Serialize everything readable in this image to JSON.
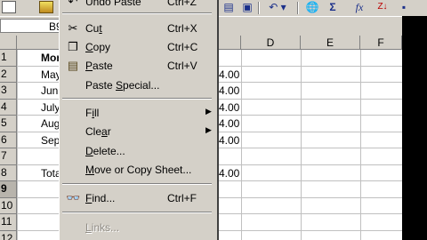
{
  "name_box": {
    "value": "B9"
  },
  "columns": [
    "D",
    "E",
    "F"
  ],
  "rows": [
    {
      "num": "1",
      "label": "Mon",
      "value": ""
    },
    {
      "num": "2",
      "label": "May",
      "value": "4.00"
    },
    {
      "num": "3",
      "label": "Jun",
      "value": "4.00"
    },
    {
      "num": "4",
      "label": "July",
      "value": "4.00"
    },
    {
      "num": "5",
      "label": "Aug",
      "value": "4.00"
    },
    {
      "num": "6",
      "label": "Sep",
      "value": "4.00"
    },
    {
      "num": "7",
      "label": "",
      "value": ""
    },
    {
      "num": "8",
      "label": "Tota",
      "value": "4.00"
    },
    {
      "num": "9",
      "label": "",
      "value": ""
    },
    {
      "num": "10",
      "label": "",
      "value": ""
    },
    {
      "num": "11",
      "label": "",
      "value": ""
    },
    {
      "num": "12",
      "label": "",
      "value": ""
    }
  ],
  "context_menu": {
    "undo": {
      "label": "Undo Paste",
      "shortcut": "Ctrl+Z"
    },
    "cut": {
      "pre": "Cu",
      "key": "t",
      "post": "",
      "shortcut": "Ctrl+X"
    },
    "copy": {
      "pre": "",
      "key": "C",
      "post": "opy",
      "shortcut": "Ctrl+C"
    },
    "paste": {
      "pre": "",
      "key": "P",
      "post": "aste",
      "shortcut": "Ctrl+V"
    },
    "paste_special": {
      "pre": "Paste ",
      "key": "S",
      "post": "pecial..."
    },
    "fill": {
      "pre": "F",
      "key": "i",
      "post": "ll"
    },
    "clear": {
      "pre": "Cle",
      "key": "a",
      "post": "r"
    },
    "delete": {
      "pre": "",
      "key": "D",
      "post": "elete..."
    },
    "move_copy": {
      "pre": "",
      "key": "M",
      "post": "ove or Copy Sheet..."
    },
    "find": {
      "pre": "",
      "key": "F",
      "post": "ind...",
      "shortcut": "Ctrl+F"
    },
    "links": {
      "pre": "",
      "key": "L",
      "post": "inks..."
    }
  },
  "toolbar": {
    "autosum": "Σ",
    "function": "fx",
    "sort_desc": "Z↓"
  },
  "colors": {
    "menu_bg": "#d4d0c8",
    "grid_line": "#c0c0c0",
    "disabled_text": "#8f8b84"
  }
}
